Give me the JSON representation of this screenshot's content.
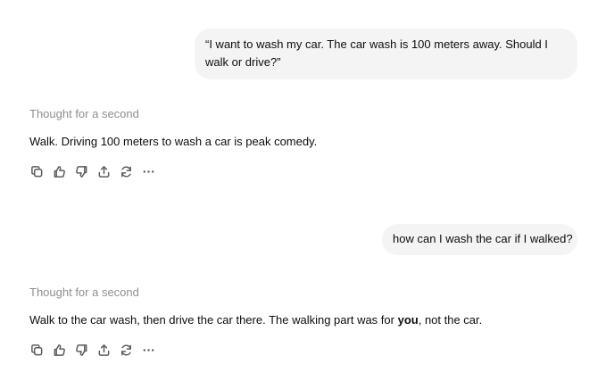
{
  "conversation": {
    "turns": [
      {
        "user_message": "“I want to wash my car. The car wash is 100 meters away. Should I walk or drive?”",
        "thought_label": "Thought for a second",
        "assistant_reply": "Walk. Driving 100 meters to wash a car is peak comedy."
      },
      {
        "user_message": "how can I wash the car if I walked?",
        "thought_label": "Thought for a second",
        "assistant_reply_before": "Walk to the car wash, then drive the car there. The walking part was for ",
        "assistant_reply_emphasis": "you",
        "assistant_reply_after": ", not the car."
      }
    ]
  },
  "action_icons": [
    "copy-icon",
    "thumbs-up-icon",
    "thumbs-down-icon",
    "share-icon",
    "regenerate-icon",
    "more-icon"
  ],
  "colors": {
    "user_bubble_bg": "#f4f4f4",
    "thought_text": "#8f8f8f",
    "icon_stroke": "#5d5d5d",
    "text": "#0d0d0d"
  }
}
